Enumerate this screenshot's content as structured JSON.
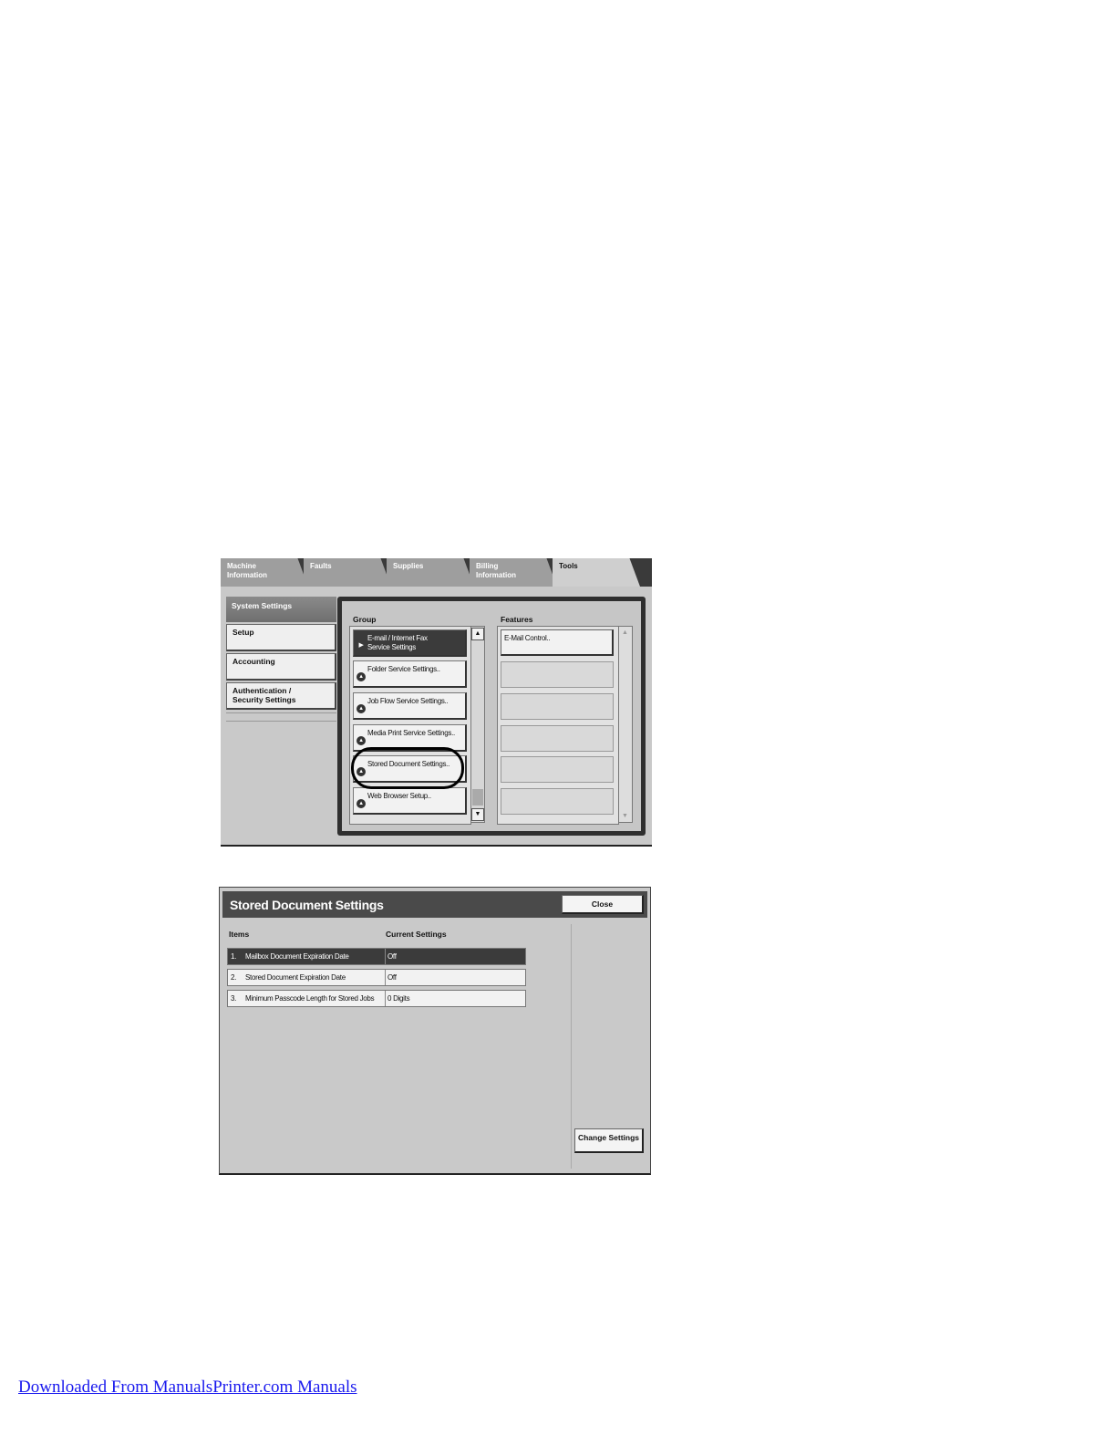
{
  "tools_screen": {
    "tabs": [
      {
        "line1": "Machine",
        "line2": "Information"
      },
      {
        "line1": "Faults",
        "line2": ""
      },
      {
        "line1": "Supplies",
        "line2": ""
      },
      {
        "line1": "Billing",
        "line2": "Information"
      },
      {
        "line1": "Tools",
        "line2": ""
      }
    ],
    "side_header": "System Settings",
    "side_items": [
      {
        "line1": "Setup",
        "line2": ""
      },
      {
        "line1": "Accounting",
        "line2": ""
      },
      {
        "line1": "Authentication /",
        "line2": "Security Settings"
      }
    ],
    "group_label": "Group",
    "features_label": "Features",
    "group_items": [
      {
        "line1": "E-mail / Internet Fax",
        "line2": "Service Settings"
      },
      {
        "line1": "Folder Service Settings..",
        "line2": ""
      },
      {
        "line1": "Job Flow Service Settings..",
        "line2": ""
      },
      {
        "line1": "Media Print Service Settings..",
        "line2": ""
      },
      {
        "line1": "Stored Document Settings..",
        "line2": ""
      },
      {
        "line1": "Web Browser Setup..",
        "line2": ""
      }
    ],
    "feature_items": [
      "E-Mail Control..",
      "",
      "",
      "",
      "",
      ""
    ]
  },
  "sds_screen": {
    "title": "Stored Document Settings",
    "close_label": "Close",
    "col_items": "Items",
    "col_current": "Current Settings",
    "rows": [
      {
        "num": "1.",
        "item": "Mailbox Document Expiration Date",
        "value": "Off"
      },
      {
        "num": "2.",
        "item": "Stored Document Expiration Date",
        "value": "Off"
      },
      {
        "num": "3.",
        "item": "Minimum Passcode Length for Stored Jobs",
        "value": "0 Digits"
      }
    ],
    "change_label": "Change Settings"
  },
  "footer_link": "Downloaded From ManualsPrinter.com Manuals"
}
